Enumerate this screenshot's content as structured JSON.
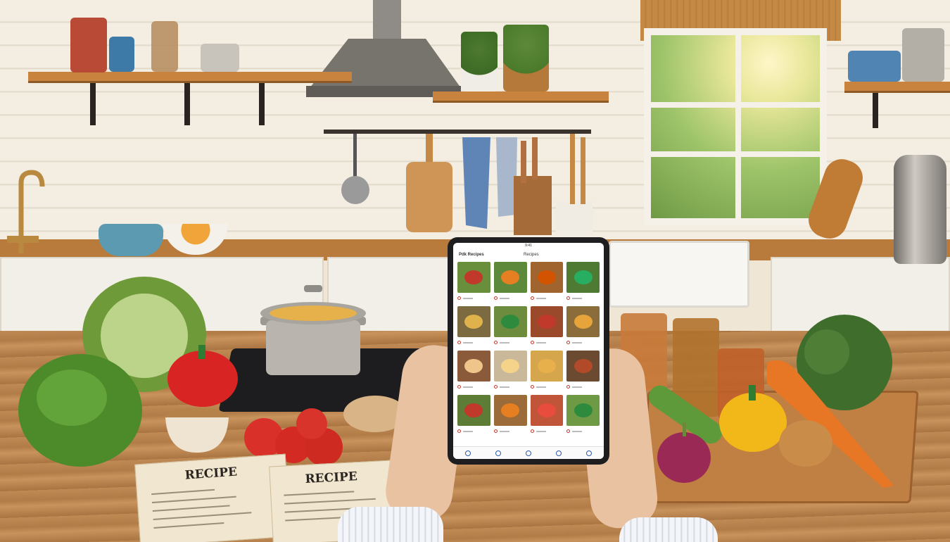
{
  "tablet": {
    "status_time": "9:41",
    "app_brand": "Pdk Recipes",
    "app_title": "Recipes",
    "thumb_colors": [
      [
        "#6a8f3c",
        "#5d8a3a",
        "#a0642f",
        "#4f7a33"
      ],
      [
        "#7c6a40",
        "#6d8c3d",
        "#9a4a2a",
        "#8a6d3b"
      ],
      [
        "#8a5a3a",
        "#c9b89a",
        "#d6a64d",
        "#6a4a30"
      ],
      [
        "#5d7c36",
        "#9c6b3a",
        "#c0553a",
        "#6f9a45"
      ]
    ],
    "dish_colors": [
      [
        "#c0392b",
        "#e67e22",
        "#d35400",
        "#27ae60"
      ],
      [
        "#e0b24c",
        "#2e8b3e",
        "#c0392b",
        "#e6a43a"
      ],
      [
        "#f0c58a",
        "#f5d38a",
        "#e8b04a",
        "#b24a2a"
      ],
      [
        "#c0392b",
        "#e67e22",
        "#e74c3c",
        "#2e8b3e"
      ]
    ],
    "nav_icons": [
      "home-icon",
      "search-icon",
      "recipe-icon",
      "cart-icon",
      "profile-icon"
    ]
  },
  "papers": [
    {
      "title": "RECIPE"
    },
    {
      "title": "RECIPE"
    }
  ]
}
